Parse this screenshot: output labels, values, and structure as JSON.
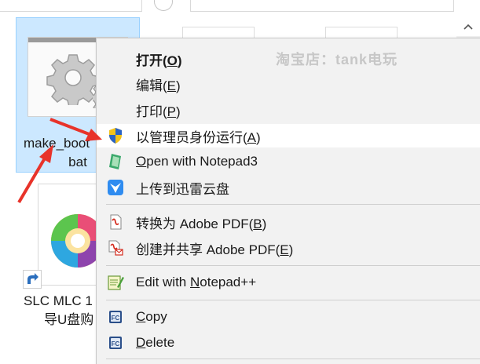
{
  "files": {
    "bat_name_line1": "make_boot",
    "bat_name_line2": "bat",
    "shortcut_name_line1": "SLC MLC 1",
    "shortcut_name_line2": "导U盘购"
  },
  "menu": {
    "watermark": "淘宝店：tank电玩",
    "items": [
      {
        "key": "open",
        "label": "打开",
        "accel": "O"
      },
      {
        "key": "edit",
        "label": "编辑",
        "accel": "E"
      },
      {
        "key": "print",
        "label": "打印",
        "accel": "P"
      },
      {
        "key": "runas",
        "label": "以管理员身份运行",
        "accel": "A"
      },
      {
        "key": "notepad3",
        "accel": "O",
        "label_rest": "pen with Notepad3"
      },
      {
        "key": "xunlei",
        "label": "上传到迅雷云盘"
      },
      {
        "key": "pdf",
        "label": "转换为 Adobe PDF",
        "accel": "B"
      },
      {
        "key": "pdfshare",
        "label": "创建并共享 Adobe PDF",
        "accel": "E"
      },
      {
        "key": "notepadpp",
        "label_pre": "Edit with ",
        "accel": "N",
        "label_rest": "otepad++"
      },
      {
        "key": "copy",
        "accel": "C",
        "label_rest": "opy"
      },
      {
        "key": "delete",
        "accel": "D",
        "label_rest": "elete"
      }
    ]
  },
  "colors": {
    "selection_bg": "#cce8ff",
    "menu_bg": "#f2f2f2",
    "arrow_red": "#e8332a"
  }
}
